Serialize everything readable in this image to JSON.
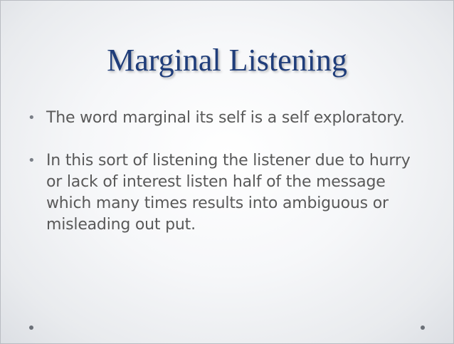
{
  "slide": {
    "title": "Marginal Listening",
    "bullets": [
      {
        "marker": "•",
        "text": "The word marginal its self is a self exploratory."
      },
      {
        "marker": "•",
        "text": " In this sort of listening the listener due to hurry or lack of interest listen half of the message which many times results into ambiguous or misleading out put."
      }
    ]
  },
  "colors": {
    "title": "#1f3d7a",
    "body_text": "#595959",
    "background_center": "#ffffff",
    "background_edge": "#dcdfe4"
  }
}
